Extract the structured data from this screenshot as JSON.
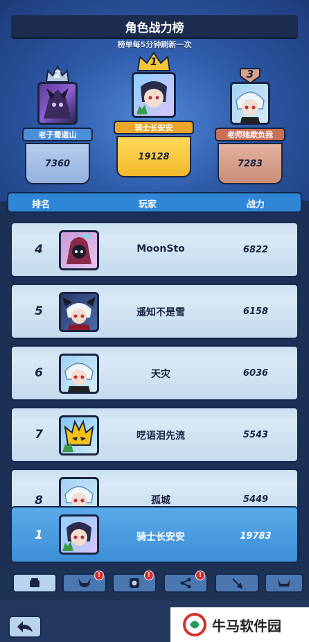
{
  "header": {
    "title": "角色战力榜",
    "subtitle": "榜单每5分钟刷新一次"
  },
  "podium": [
    {
      "place": "2",
      "name": "老子蜀道山",
      "power": "7360"
    },
    {
      "place": "1",
      "name": "骑士长安安",
      "power": "19128"
    },
    {
      "place": "3",
      "name": "老师她欺负我",
      "power": "7283"
    }
  ],
  "table": {
    "columns": [
      "排名",
      "玩家",
      "战力"
    ],
    "rows": [
      {
        "rank": "4",
        "name": "MoonSto",
        "power": "6822"
      },
      {
        "rank": "5",
        "name": "遥知不是雪",
        "power": "6158"
      },
      {
        "rank": "6",
        "name": "天灾",
        "power": "6036"
      },
      {
        "rank": "7",
        "name": "呓语泪先流",
        "power": "5543"
      },
      {
        "rank": "8",
        "name": "孤城",
        "power": "5449"
      }
    ]
  },
  "my_entry": {
    "rank": "1",
    "name": "骑士长安安",
    "power": "19783"
  },
  "tabs": [
    {
      "icon": "fist-icon",
      "active": true,
      "notify": ""
    },
    {
      "icon": "horned-helmet-icon",
      "active": false,
      "notify": "!"
    },
    {
      "icon": "shield-emblem-icon",
      "active": false,
      "notify": "!"
    },
    {
      "icon": "network-icon",
      "active": false,
      "notify": "!"
    },
    {
      "icon": "sword-icon",
      "active": false,
      "notify": ""
    },
    {
      "icon": "viking-helmet-icon",
      "active": false,
      "notify": ""
    }
  ],
  "watermark": {
    "text": "牛马软件园"
  },
  "colors": {
    "gold": "#f5c53a",
    "silver": "#9db5d8",
    "bronze": "#d9a08a",
    "accent_blue": "#2f86d6",
    "notify_red": "#d52a2a"
  }
}
